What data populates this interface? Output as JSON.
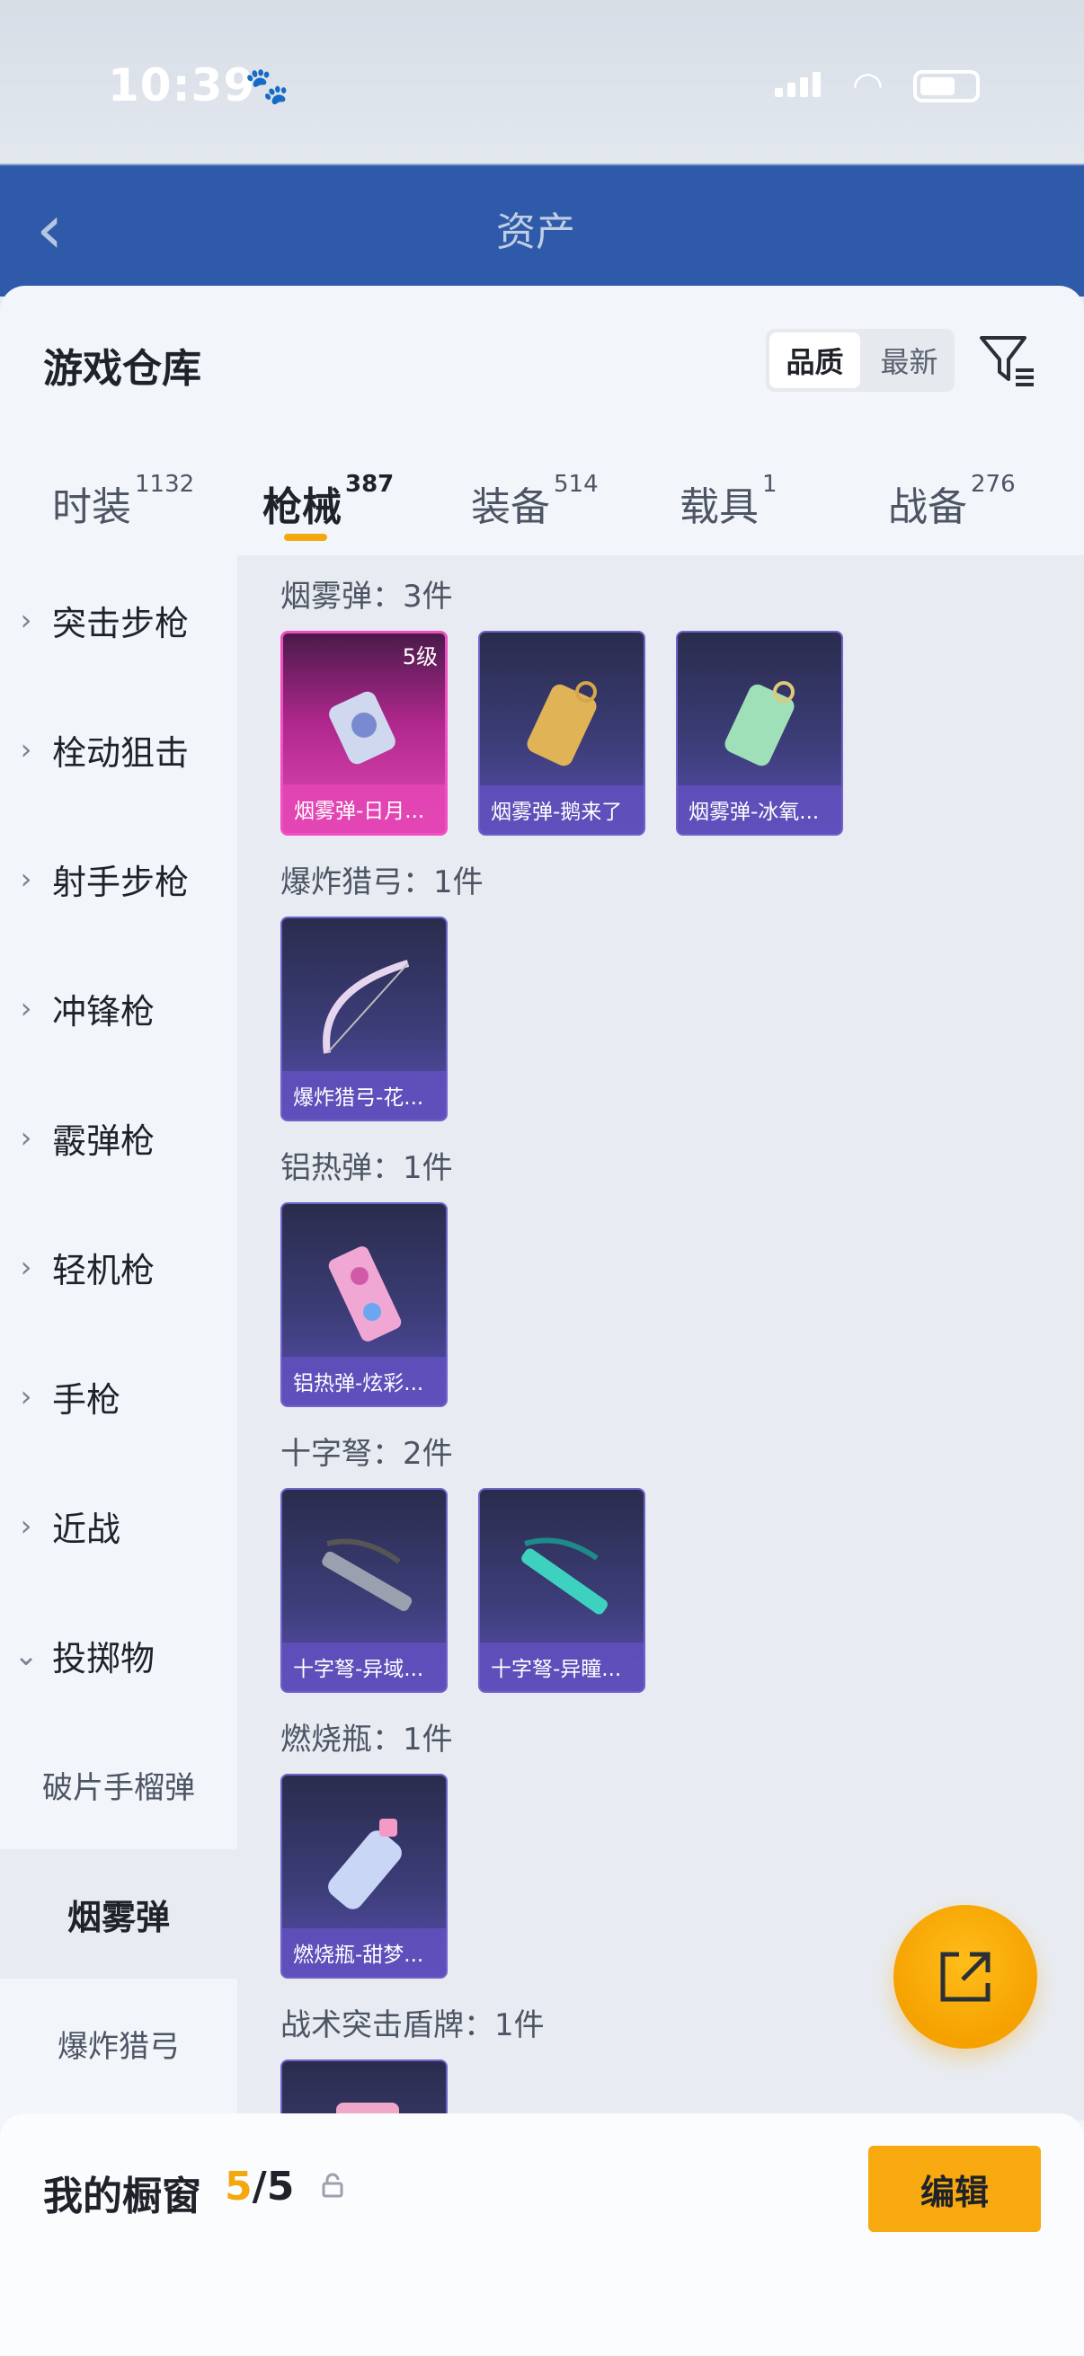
{
  "status": {
    "time": "10:39"
  },
  "backdrop": {
    "title": "资产"
  },
  "header": {
    "title": "游戏仓库",
    "sort_options": [
      "品质",
      "最新"
    ],
    "active_sort": "品质"
  },
  "tabs": [
    {
      "label": "时装",
      "count": "1132"
    },
    {
      "label": "枪械",
      "count": "387"
    },
    {
      "label": "装备",
      "count": "514"
    },
    {
      "label": "载具",
      "count": "1"
    },
    {
      "label": "战备",
      "count": "276"
    }
  ],
  "sidebar": {
    "categories": [
      "突击步枪",
      "栓动狙击",
      "射手步枪",
      "冲锋枪",
      "霰弹枪",
      "轻机枪",
      "手枪",
      "近战",
      "投掷物"
    ],
    "subitems": [
      "破片手榴弹",
      "烟雾弹",
      "爆炸猎弓"
    ]
  },
  "sections": [
    {
      "title": "烟雾弹：3件",
      "items": [
        {
          "name": "烟雾弹-日月...",
          "level": "5级",
          "rarity": "gold"
        },
        {
          "name": "烟雾弹-鹅来了"
        },
        {
          "name": "烟雾弹-冰氧..."
        }
      ]
    },
    {
      "title": "爆炸猎弓：1件",
      "items": [
        {
          "name": "爆炸猎弓-花..."
        }
      ]
    },
    {
      "title": "铝热弹：1件",
      "items": [
        {
          "name": "铝热弹-炫彩..."
        }
      ]
    },
    {
      "title": "十字弩：2件",
      "items": [
        {
          "name": "十字弩-异域..."
        },
        {
          "name": "十字弩-异瞳..."
        }
      ]
    },
    {
      "title": "燃烧瓶：1件",
      "items": [
        {
          "name": "燃烧瓶-甜梦..."
        }
      ]
    },
    {
      "title": "战术突击盾牌：1件",
      "items": []
    }
  ],
  "showcase": {
    "title": "我的橱窗",
    "current": "5",
    "total": "/5",
    "edit_label": "编辑"
  },
  "colors": {
    "accent": "#f3a90d",
    "card_purple": "#5b4fb1",
    "card_gold": "#e04cb6"
  }
}
